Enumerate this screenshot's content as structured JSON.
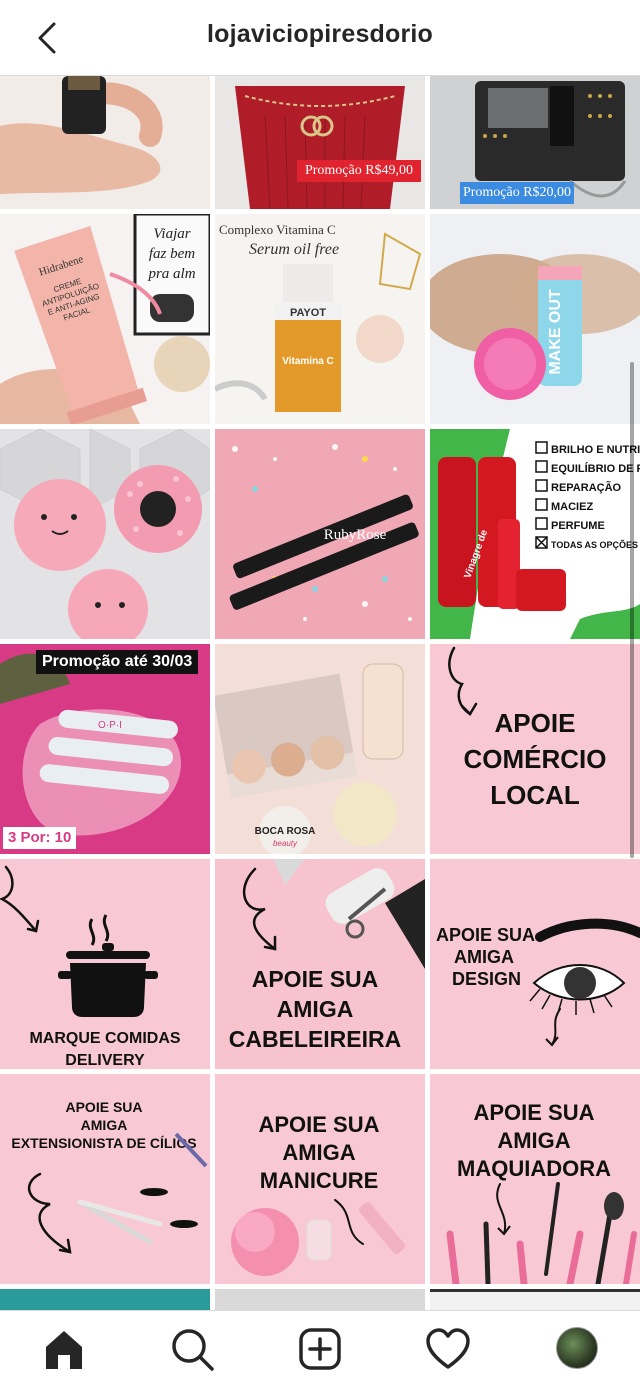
{
  "header": {
    "title": "lojaviciopiresdorio"
  },
  "posts": {
    "promo_bag_red": "Promoção R$49,00",
    "promo_bag_black": "Promoção R$20,00",
    "hidrabene_brand": "Hidrabene",
    "hidrabene_text1": "CREME",
    "hidrabene_text2": "ANTIPOLUIÇÃO",
    "hidrabene_text3": "E ANTI-AGING",
    "hidrabene_text4": "FACIAL",
    "poster_line1": "Viajar",
    "poster_line2": "faz bem",
    "poster_line3": "pra alm",
    "vitc_title": "Complexo Vitamina C",
    "vitc_subtitle": "Serum oil free",
    "vitc_brand": "PAYOT",
    "vitc_label": "Vitamina C",
    "makeup_text": "MAKE OUT",
    "liner_brand": "RubyRose",
    "vinagre_items": [
      "BRILHO E NUTRIÇÃO",
      "EQUILÍBRIO DE PH",
      "REPARAÇÃO",
      "MACIEZ",
      "PERFUME",
      "TODAS AS OPÇÕES ACIMA"
    ],
    "vinagre_label": "Vinagre de",
    "opi_promo": "Promoção até 30/03",
    "opi_brand": "O·P·I",
    "opi_price": "3 Por: 10",
    "boca_rosa": "BOCA ROSA",
    "boca_rosa_sub": "beauty",
    "apoie_local": [
      "APOIE",
      "COMÉRCIO",
      "LOCAL"
    ],
    "comidas": [
      "MARQUE COMIDAS",
      "DELIVERY"
    ],
    "cabeleireira": [
      "APOIE SUA",
      "AMIGA",
      "CABELEIREIRA"
    ],
    "design": [
      "APOIE SUA",
      "AMIGA",
      "DESIGN"
    ],
    "cilios": [
      "APOIE SUA",
      "AMIGA",
      "EXTENSIONISTA DE CÍLIOS"
    ],
    "manicure": [
      "APOIE SUA",
      "AMIGA",
      "MANICURE"
    ],
    "maquiadora": [
      "APOIE SUA",
      "AMIGA",
      "MAQUIADORA"
    ]
  },
  "colors": {
    "pink_bg": "#f8c9d4",
    "light_pink": "#f9d3dc",
    "promo_red": "#e0232e",
    "promo_blue": "#3b8be0",
    "text_dark": "#111111"
  },
  "tabs": [
    "home-icon",
    "search-icon",
    "add-post-icon",
    "heart-icon",
    "profile-avatar"
  ]
}
